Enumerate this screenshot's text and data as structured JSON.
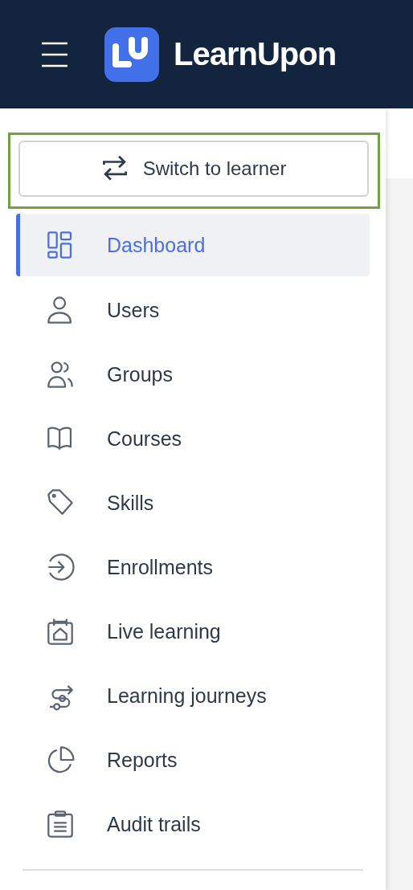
{
  "header": {
    "brand": "LearnUpon"
  },
  "switch_button": {
    "label": "Switch to learner",
    "focused": true
  },
  "nav": [
    {
      "label": "Dashboard",
      "selected": true
    },
    {
      "label": "Users",
      "selected": false
    },
    {
      "label": "Groups",
      "selected": false
    },
    {
      "label": "Courses",
      "selected": false
    },
    {
      "label": "Skills",
      "selected": false
    },
    {
      "label": "Enrollments",
      "selected": false
    },
    {
      "label": "Live learning",
      "selected": false
    },
    {
      "label": "Learning journeys",
      "selected": false
    },
    {
      "label": "Reports",
      "selected": false
    },
    {
      "label": "Audit trails",
      "selected": false
    }
  ]
}
